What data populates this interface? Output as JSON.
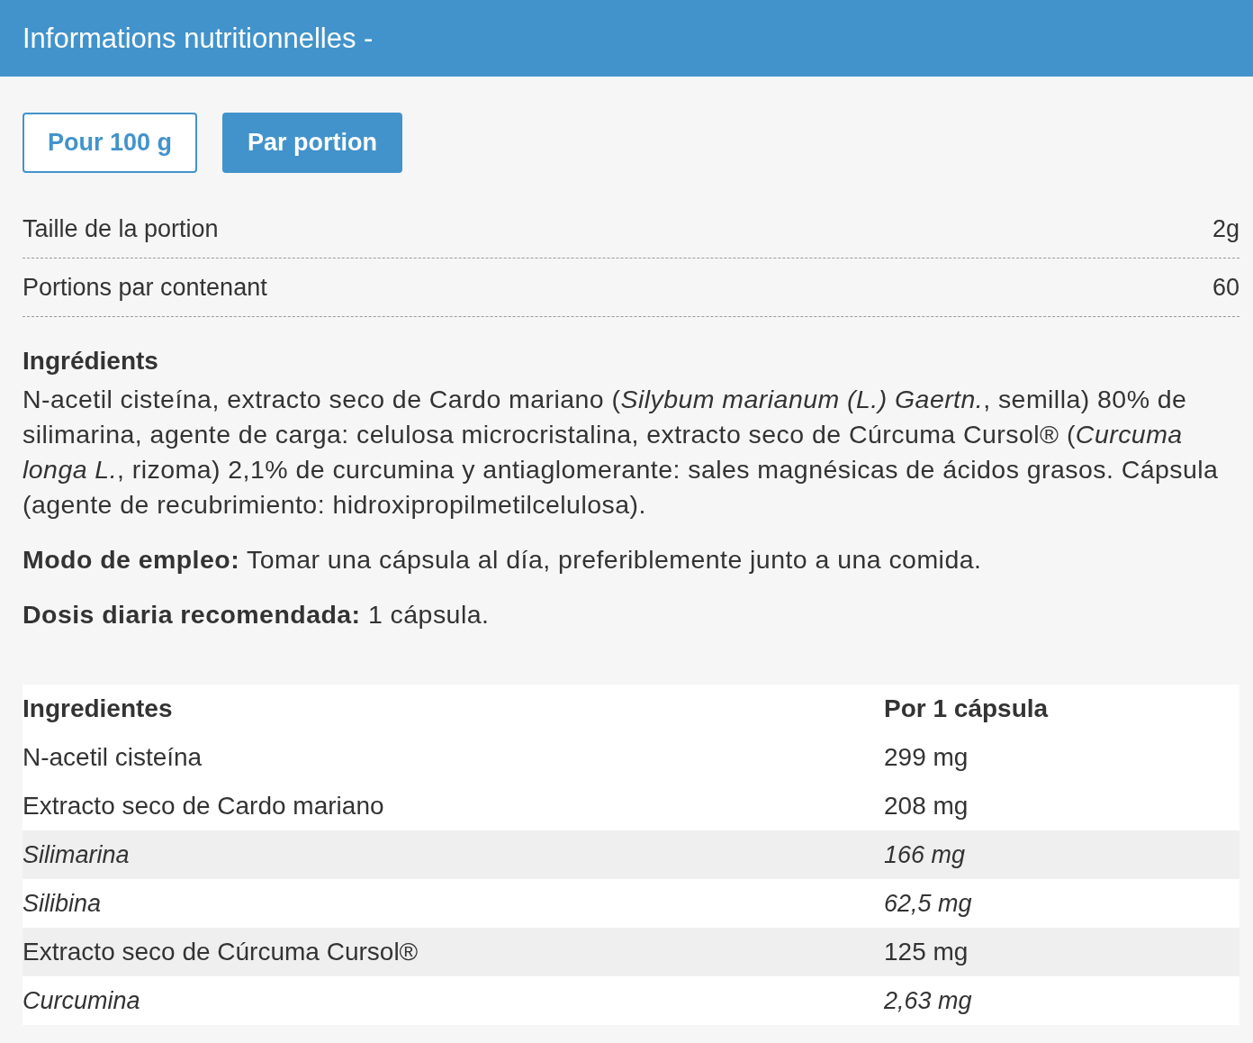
{
  "header": {
    "title": "Informations nutritionnelles -"
  },
  "tabs": [
    {
      "label": "Pour 100 g",
      "selected": false
    },
    {
      "label": "Par portion",
      "selected": true
    }
  ],
  "facts": [
    {
      "label": "Taille de la portion",
      "value": "2g"
    },
    {
      "label": "Portions par contenant",
      "value": "60"
    }
  ],
  "ingredients": {
    "heading": "Ingrédients",
    "text": "N-acetil cisteína, extracto seco de Cardo mariano (*Silybum marianum (L.) Gaertn.*, semilla) 80% de silimarina, agente de carga: celulosa microcristalina, extracto seco de Cúrcuma Cursol® (*Curcuma longa L.*, rizoma) 2,1% de curcumina y antiaglomerante: sales magnésicas de ácidos grasos. Cápsula (agente de recubrimiento: hidroxipropilmetilcelulosa)."
  },
  "usage": "**Modo de empleo:** Tomar una cápsula al día, preferiblemente junto a una comida.",
  "dose": "**Dosis diaria recomendada:** 1 cápsula.",
  "table": {
    "columns": [
      "Ingredientes",
      "Por 1 cápsula"
    ],
    "rows": [
      {
        "kind": "main",
        "shaded": false,
        "cells": [
          "N-acetil cisteína",
          "299 mg"
        ]
      },
      {
        "kind": "main",
        "shaded": false,
        "cells": [
          "Extracto seco de Cardo mariano",
          "208 mg"
        ]
      },
      {
        "kind": "sub",
        "shaded": true,
        "cells": [
          "Silimarina",
          "166 mg"
        ]
      },
      {
        "kind": "sub",
        "shaded": false,
        "cells": [
          "Silibina",
          "62,5 mg"
        ]
      },
      {
        "kind": "main",
        "shaded": true,
        "cells": [
          "Extracto seco de Cúrcuma Cursol®",
          "125 mg"
        ]
      },
      {
        "kind": "sub",
        "shaded": false,
        "cells": [
          "Curcumina",
          "2,63 mg"
        ]
      }
    ]
  }
}
